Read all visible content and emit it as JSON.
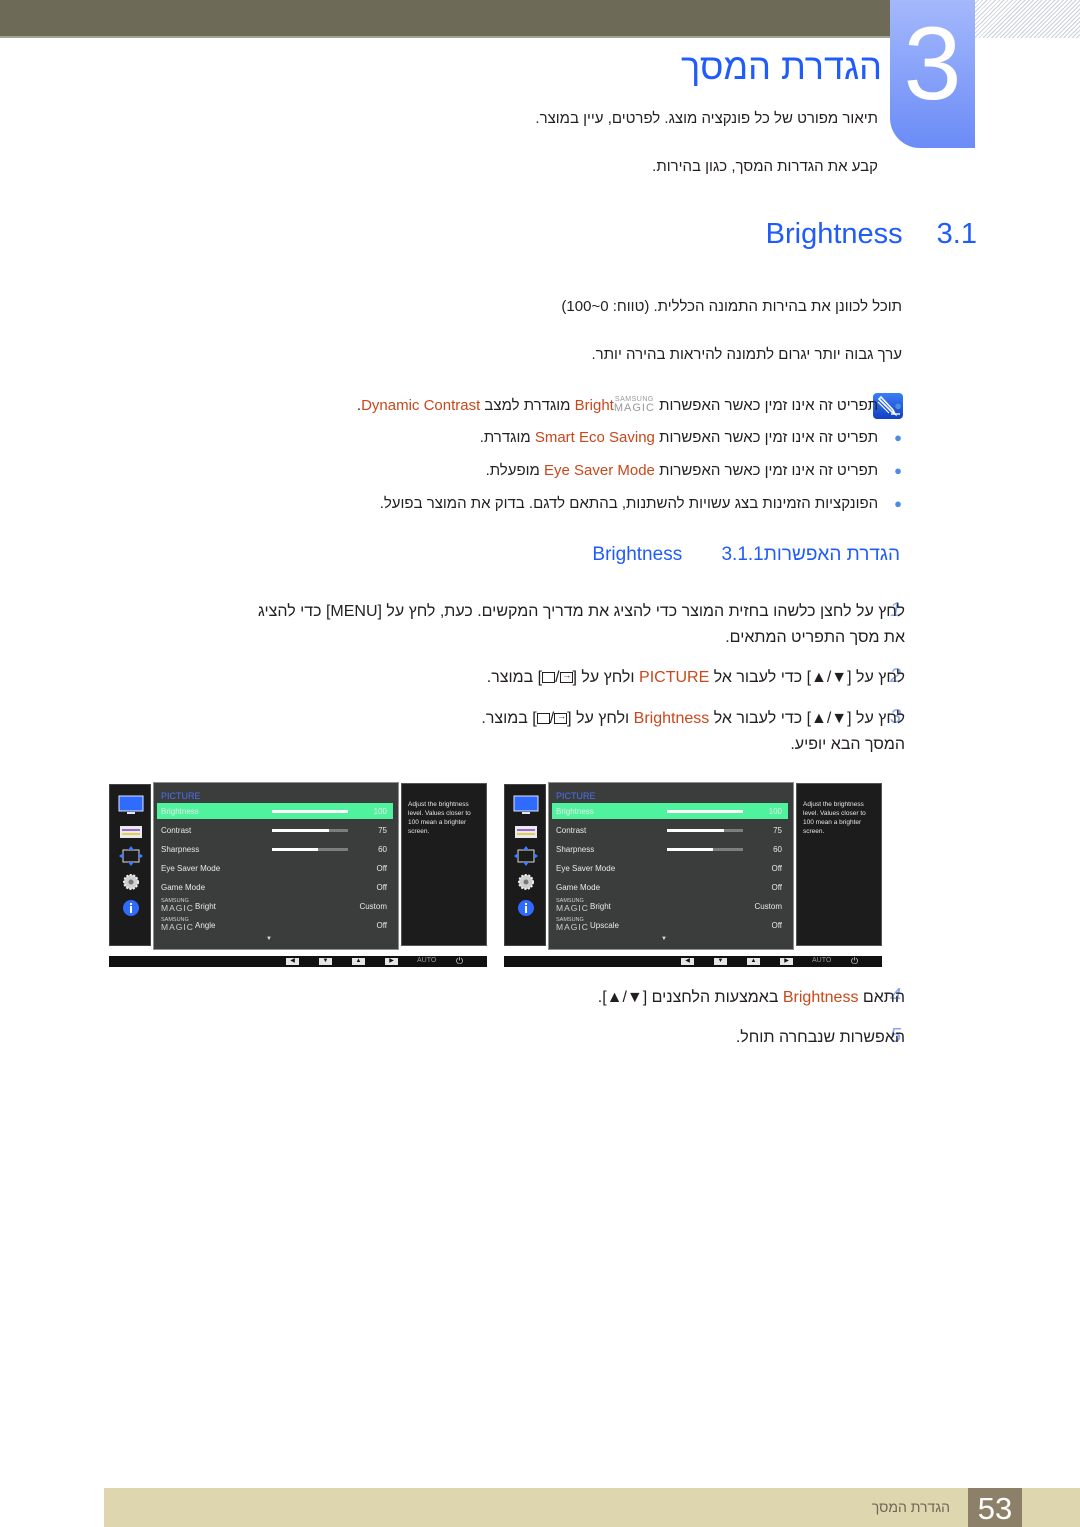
{
  "header": {
    "chapter_number": "3",
    "chapter_title": "הגדרת המסך",
    "intro_lines": [
      "תיאור מפורט של כל פונקציה מוצג. לפרטים, עיין במוצר.",
      "קבע את הגדרות המסך, כגון בהירות."
    ]
  },
  "section": {
    "number": "3.1",
    "title": "Brightness",
    "paragraphs": [
      "תוכל לכוונן את בהירות התמונה הכללית. (טווח: 0~100)",
      "ערך גבוה יותר יגרום לתמונה להיראות בהירה יותר."
    ],
    "note_icon": "note-pencil-icon",
    "bullets": [
      {
        "before": "תפריט זה אינו זמין כאשר האפשרות ",
        "magic": {
          "top": "SAMSUNG",
          "bottom": "MAGIC"
        },
        "highlight": "Bright",
        "middle": " מוגדרת למצב ",
        "highlight2": "Dynamic Contrast",
        "after": "."
      },
      {
        "before": "תפריט זה אינו זמין כאשר האפשרות ",
        "highlight": "Smart Eco Saving",
        "after": " מוגדרת."
      },
      {
        "before": "תפריט זה אינו זמין כאשר האפשרות ",
        "highlight": "Eye Saver Mode",
        "after": " מופעלת."
      },
      {
        "before": "הפונקציות הזמינות בצג עשויות להשתנות, בהתאם לדגם. בדוק את המוצר בפועל.",
        "after": ""
      }
    ]
  },
  "subsection": {
    "number": "3.1.1",
    "title_he": "הגדרת האפשרות",
    "title_en": "Brightness",
    "steps": [
      {
        "num": "1",
        "line1": "לחץ על לחצן כלשהו בחזית המוצר כדי להציג את מדריך המקשים. כעת, לחץ על [MENU] כדי להציג",
        "line2": "את מסך התפריט המתאים."
      },
      {
        "num": "2",
        "pre": "לחץ על [▼/▲] כדי לעבור אל ",
        "highlight": "PICTURE",
        "post": " ולחץ על [",
        "post2": "] במוצר."
      },
      {
        "num": "3",
        "pre": "לחץ על [▼/▲] כדי לעבור אל ",
        "highlight": "Brightness",
        "post": " ולחץ על [",
        "post2": "] במוצר.",
        "line2": "המסך הבא יופיע."
      },
      {
        "num": "4",
        "pre": "התאם ",
        "highlight": "Brightness",
        "post": " באמצעות הלחצנים [▼/▲]."
      },
      {
        "num": "5",
        "pre": "האפשרות שנבחרה תוחל."
      }
    ]
  },
  "osd_screens": [
    {
      "menu_title": "PICTURE",
      "side_icons": [
        "monitor-icon",
        "color-bars-icon",
        "resize-arrows-icon",
        "gear-icon",
        "info-icon"
      ],
      "rows": [
        {
          "label": "Brightness",
          "value": "100",
          "level": 100,
          "selected": true
        },
        {
          "label": "Contrast",
          "value": "75",
          "level": 75
        },
        {
          "label": "Sharpness",
          "value": "60",
          "level": 60
        },
        {
          "label": "Eye Saver Mode",
          "value": "Off"
        },
        {
          "label": "Game Mode",
          "value": "Off"
        },
        {
          "magic": true,
          "label": "Bright",
          "value": "Custom"
        },
        {
          "magic": true,
          "label": "Angle",
          "value": "Off"
        }
      ],
      "help_text": "Adjust the brightness level. Values closer to 100 mean a brighter screen.",
      "buttons": [
        "◀",
        "▼",
        "▲",
        "▶"
      ],
      "auto_label": "AUTO",
      "power_icon": "⏻"
    },
    {
      "menu_title": "PICTURE",
      "side_icons": [
        "monitor-icon",
        "color-bars-icon",
        "resize-arrows-icon",
        "gear-icon",
        "info-icon"
      ],
      "rows": [
        {
          "label": "Brightness",
          "value": "100",
          "level": 100,
          "selected": true
        },
        {
          "label": "Contrast",
          "value": "75",
          "level": 75
        },
        {
          "label": "Sharpness",
          "value": "60",
          "level": 60
        },
        {
          "label": "Eye Saver Mode",
          "value": "Off"
        },
        {
          "label": "Game Mode",
          "value": "Off"
        },
        {
          "magic": true,
          "label": "Bright",
          "value": "Custom"
        },
        {
          "magic": true,
          "label": "Upscale",
          "value": "Off"
        }
      ],
      "help_text": "Adjust the brightness level. Values closer to 100 mean a brighter screen.",
      "buttons": [
        "◀",
        "▼",
        "▲",
        "▶"
      ],
      "auto_label": "AUTO",
      "power_icon": "⏻"
    }
  ],
  "magic_logo": {
    "top": "SAMSUNG",
    "bottom": "MAGIC"
  },
  "footer": {
    "label": "הגדרת המסך",
    "page_number": "53"
  },
  "colors": {
    "accent_blue": "#1f5cf9",
    "highlight_orange": "#c9471b",
    "osd_selected": "#4ff29d"
  }
}
